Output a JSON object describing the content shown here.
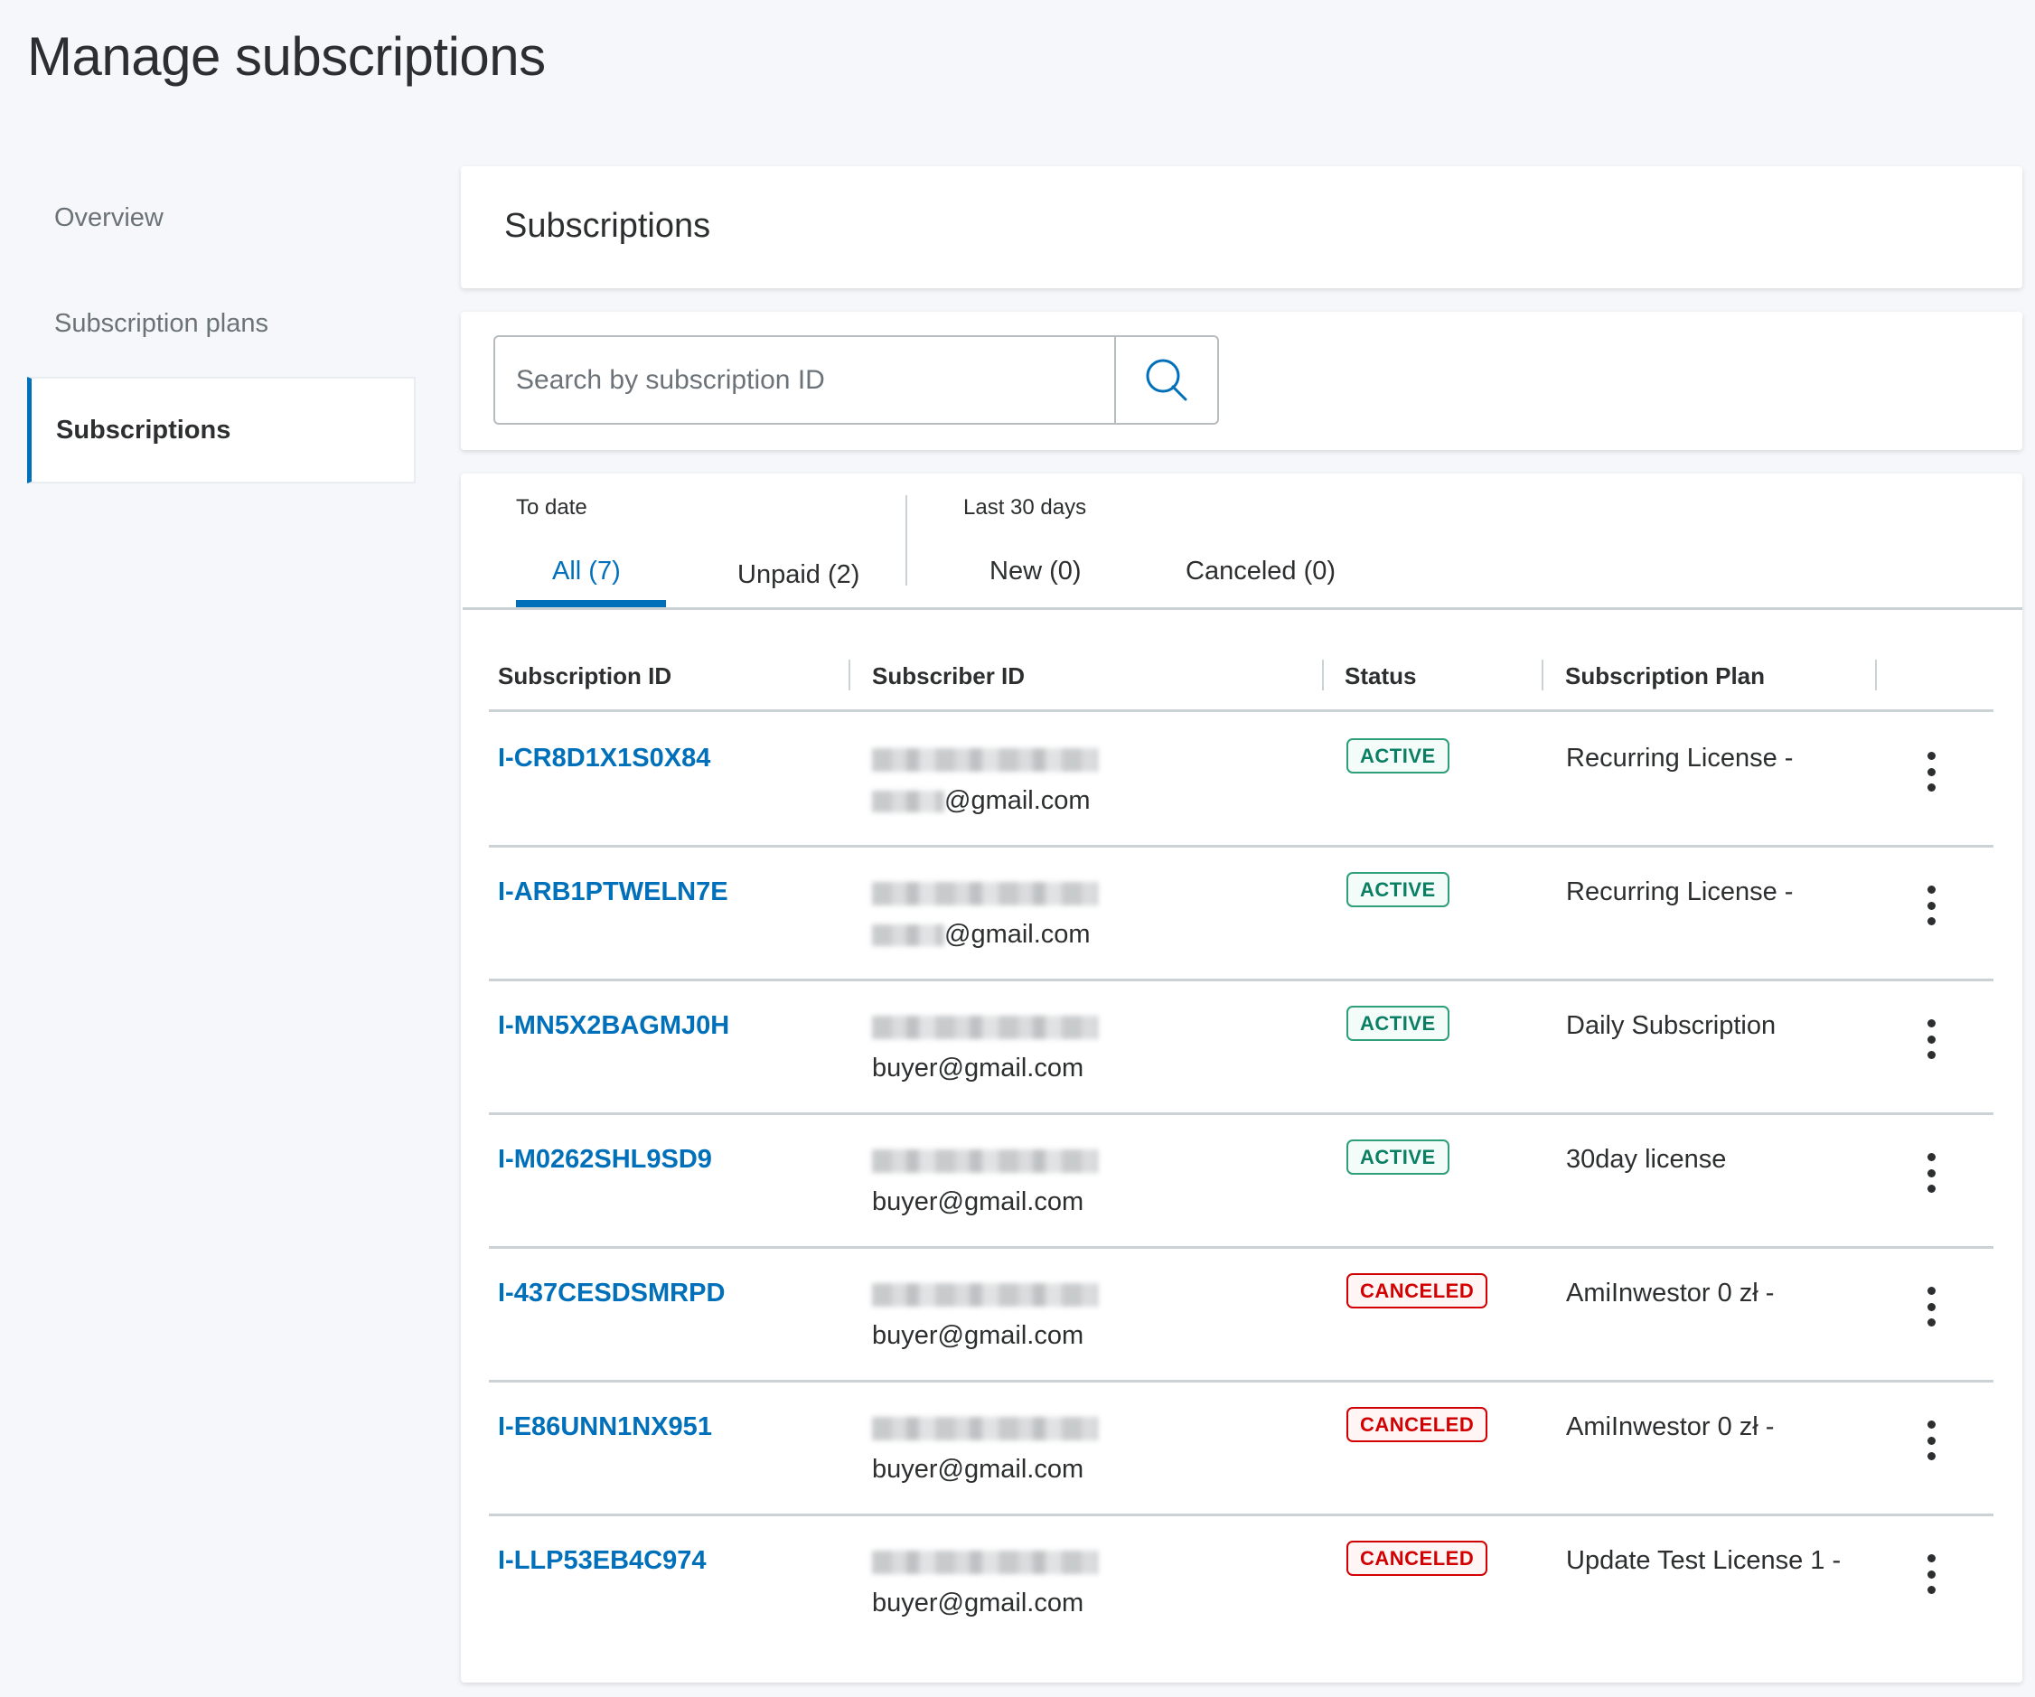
{
  "page": {
    "title": "Manage subscriptions"
  },
  "sidebar": {
    "items": [
      {
        "label": "Overview",
        "active": false
      },
      {
        "label": "Subscription plans",
        "active": false
      },
      {
        "label": "Subscriptions",
        "active": true
      }
    ]
  },
  "header_card": {
    "title": "Subscriptions"
  },
  "search": {
    "placeholder": "Search by subscription ID",
    "value": "",
    "button_icon": "search-icon"
  },
  "filters": {
    "groups": [
      {
        "label": "To date",
        "tabs": [
          {
            "label": "All (7)",
            "active": true
          },
          {
            "label": "Unpaid (2)",
            "active": false
          }
        ]
      },
      {
        "label": "Last 30 days",
        "tabs": [
          {
            "label": "New (0)",
            "active": false
          },
          {
            "label": "Canceled (0)",
            "active": false
          }
        ]
      }
    ]
  },
  "table": {
    "columns": [
      "Subscription ID",
      "Subscriber ID",
      "Status",
      "Subscription Plan"
    ],
    "rows": [
      {
        "id": "I-CR8D1X1S0X84",
        "subscriber_name": "[redacted]",
        "email": "@gmail.com",
        "email_prefix_redacted": true,
        "status": "ACTIVE",
        "plan": "Recurring License -"
      },
      {
        "id": "I-ARB1PTWELN7E",
        "subscriber_name": "[redacted]",
        "email": "@gmail.com",
        "email_prefix_redacted": true,
        "status": "ACTIVE",
        "plan": "Recurring License -"
      },
      {
        "id": "I-MN5X2BAGMJ0H",
        "subscriber_name": "[redacted]",
        "email": "buyer@gmail.com",
        "email_prefix_redacted": false,
        "status": "ACTIVE",
        "plan": "Daily Subscription"
      },
      {
        "id": "I-M0262SHL9SD9",
        "subscriber_name": "[redacted]",
        "email": "buyer@gmail.com",
        "email_prefix_redacted": false,
        "status": "ACTIVE",
        "plan": "30day license"
      },
      {
        "id": "I-437CESDSMRPD",
        "subscriber_name": "[redacted]",
        "email": "buyer@gmail.com",
        "email_prefix_redacted": false,
        "status": "CANCELED",
        "plan": "AmiInwestor 0 zł -"
      },
      {
        "id": "I-E86UNN1NX951",
        "subscriber_name": "[redacted]",
        "email": "buyer@gmail.com",
        "email_prefix_redacted": false,
        "status": "CANCELED",
        "plan": "AmiInwestor 0 zł -"
      },
      {
        "id": "I-LLP53EB4C974",
        "subscriber_name": "[redacted]",
        "email": "buyer@gmail.com",
        "email_prefix_redacted": false,
        "status": "CANCELED",
        "plan": "Update Test License 1 -"
      }
    ],
    "row_action_icon": "more-vertical-icon"
  },
  "colors": {
    "accent": "#0070ba",
    "active_status": "#0a7f63",
    "canceled_status": "#d20000",
    "background": "#f5f7fa"
  }
}
